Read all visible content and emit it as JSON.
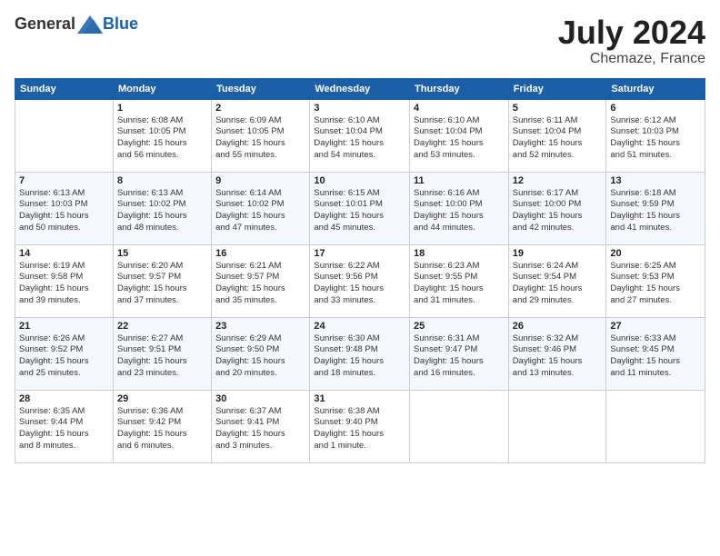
{
  "header": {
    "logo_general": "General",
    "logo_blue": "Blue",
    "month_year": "July 2024",
    "location": "Chemaze, France"
  },
  "days_of_week": [
    "Sunday",
    "Monday",
    "Tuesday",
    "Wednesday",
    "Thursday",
    "Friday",
    "Saturday"
  ],
  "weeks": [
    [
      {
        "day": "",
        "info": ""
      },
      {
        "day": "1",
        "info": "Sunrise: 6:08 AM\nSunset: 10:05 PM\nDaylight: 15 hours\nand 56 minutes."
      },
      {
        "day": "2",
        "info": "Sunrise: 6:09 AM\nSunset: 10:05 PM\nDaylight: 15 hours\nand 55 minutes."
      },
      {
        "day": "3",
        "info": "Sunrise: 6:10 AM\nSunset: 10:04 PM\nDaylight: 15 hours\nand 54 minutes."
      },
      {
        "day": "4",
        "info": "Sunrise: 6:10 AM\nSunset: 10:04 PM\nDaylight: 15 hours\nand 53 minutes."
      },
      {
        "day": "5",
        "info": "Sunrise: 6:11 AM\nSunset: 10:04 PM\nDaylight: 15 hours\nand 52 minutes."
      },
      {
        "day": "6",
        "info": "Sunrise: 6:12 AM\nSunset: 10:03 PM\nDaylight: 15 hours\nand 51 minutes."
      }
    ],
    [
      {
        "day": "7",
        "info": "Sunrise: 6:13 AM\nSunset: 10:03 PM\nDaylight: 15 hours\nand 50 minutes."
      },
      {
        "day": "8",
        "info": "Sunrise: 6:13 AM\nSunset: 10:02 PM\nDaylight: 15 hours\nand 48 minutes."
      },
      {
        "day": "9",
        "info": "Sunrise: 6:14 AM\nSunset: 10:02 PM\nDaylight: 15 hours\nand 47 minutes."
      },
      {
        "day": "10",
        "info": "Sunrise: 6:15 AM\nSunset: 10:01 PM\nDaylight: 15 hours\nand 45 minutes."
      },
      {
        "day": "11",
        "info": "Sunrise: 6:16 AM\nSunset: 10:00 PM\nDaylight: 15 hours\nand 44 minutes."
      },
      {
        "day": "12",
        "info": "Sunrise: 6:17 AM\nSunset: 10:00 PM\nDaylight: 15 hours\nand 42 minutes."
      },
      {
        "day": "13",
        "info": "Sunrise: 6:18 AM\nSunset: 9:59 PM\nDaylight: 15 hours\nand 41 minutes."
      }
    ],
    [
      {
        "day": "14",
        "info": "Sunrise: 6:19 AM\nSunset: 9:58 PM\nDaylight: 15 hours\nand 39 minutes."
      },
      {
        "day": "15",
        "info": "Sunrise: 6:20 AM\nSunset: 9:57 PM\nDaylight: 15 hours\nand 37 minutes."
      },
      {
        "day": "16",
        "info": "Sunrise: 6:21 AM\nSunset: 9:57 PM\nDaylight: 15 hours\nand 35 minutes."
      },
      {
        "day": "17",
        "info": "Sunrise: 6:22 AM\nSunset: 9:56 PM\nDaylight: 15 hours\nand 33 minutes."
      },
      {
        "day": "18",
        "info": "Sunrise: 6:23 AM\nSunset: 9:55 PM\nDaylight: 15 hours\nand 31 minutes."
      },
      {
        "day": "19",
        "info": "Sunrise: 6:24 AM\nSunset: 9:54 PM\nDaylight: 15 hours\nand 29 minutes."
      },
      {
        "day": "20",
        "info": "Sunrise: 6:25 AM\nSunset: 9:53 PM\nDaylight: 15 hours\nand 27 minutes."
      }
    ],
    [
      {
        "day": "21",
        "info": "Sunrise: 6:26 AM\nSunset: 9:52 PM\nDaylight: 15 hours\nand 25 minutes."
      },
      {
        "day": "22",
        "info": "Sunrise: 6:27 AM\nSunset: 9:51 PM\nDaylight: 15 hours\nand 23 minutes."
      },
      {
        "day": "23",
        "info": "Sunrise: 6:29 AM\nSunset: 9:50 PM\nDaylight: 15 hours\nand 20 minutes."
      },
      {
        "day": "24",
        "info": "Sunrise: 6:30 AM\nSunset: 9:48 PM\nDaylight: 15 hours\nand 18 minutes."
      },
      {
        "day": "25",
        "info": "Sunrise: 6:31 AM\nSunset: 9:47 PM\nDaylight: 15 hours\nand 16 minutes."
      },
      {
        "day": "26",
        "info": "Sunrise: 6:32 AM\nSunset: 9:46 PM\nDaylight: 15 hours\nand 13 minutes."
      },
      {
        "day": "27",
        "info": "Sunrise: 6:33 AM\nSunset: 9:45 PM\nDaylight: 15 hours\nand 11 minutes."
      }
    ],
    [
      {
        "day": "28",
        "info": "Sunrise: 6:35 AM\nSunset: 9:44 PM\nDaylight: 15 hours\nand 8 minutes."
      },
      {
        "day": "29",
        "info": "Sunrise: 6:36 AM\nSunset: 9:42 PM\nDaylight: 15 hours\nand 6 minutes."
      },
      {
        "day": "30",
        "info": "Sunrise: 6:37 AM\nSunset: 9:41 PM\nDaylight: 15 hours\nand 3 minutes."
      },
      {
        "day": "31",
        "info": "Sunrise: 6:38 AM\nSunset: 9:40 PM\nDaylight: 15 hours\nand 1 minute."
      },
      {
        "day": "",
        "info": ""
      },
      {
        "day": "",
        "info": ""
      },
      {
        "day": "",
        "info": ""
      }
    ]
  ]
}
